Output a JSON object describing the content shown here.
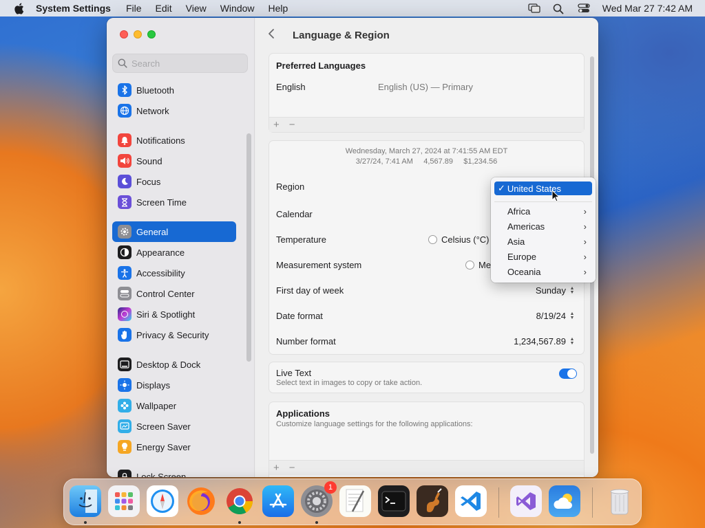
{
  "menubar": {
    "app_name": "System Settings",
    "menus": [
      "File",
      "Edit",
      "View",
      "Window",
      "Help"
    ],
    "datetime": "Wed Mar 27  7:42 AM"
  },
  "sidebar": {
    "search_placeholder": "Search",
    "items": [
      {
        "label": "Bluetooth",
        "icon": "bluetooth-icon",
        "color": "#1a73e8"
      },
      {
        "label": "Network",
        "icon": "globe-icon",
        "color": "#1a73e8"
      },
      {
        "label": "Notifications",
        "icon": "bell-icon",
        "color": "#f2453d"
      },
      {
        "label": "Sound",
        "icon": "speaker-icon",
        "color": "#f2453d"
      },
      {
        "label": "Focus",
        "icon": "moon-icon",
        "color": "#5b4fd8"
      },
      {
        "label": "Screen Time",
        "icon": "hourglass-icon",
        "color": "#6a4fd8"
      },
      {
        "label": "General",
        "icon": "gear-icon",
        "color": "#8e8e93"
      },
      {
        "label": "Appearance",
        "icon": "appearance-icon",
        "color": "#1d1d1f"
      },
      {
        "label": "Accessibility",
        "icon": "accessibility-icon",
        "color": "#1a73e8"
      },
      {
        "label": "Control Center",
        "icon": "control-center-icon",
        "color": "#8e8e93"
      },
      {
        "label": "Siri & Spotlight",
        "icon": "siri-icon",
        "color": "#c23bd4"
      },
      {
        "label": "Privacy & Security",
        "icon": "hand-icon",
        "color": "#1a73e8"
      },
      {
        "label": "Desktop & Dock",
        "icon": "dock-icon",
        "color": "#1d1d1f"
      },
      {
        "label": "Displays",
        "icon": "sun-icon",
        "color": "#1a73e8"
      },
      {
        "label": "Wallpaper",
        "icon": "flower-icon",
        "color": "#32aee8"
      },
      {
        "label": "Screen Saver",
        "icon": "screensaver-icon",
        "color": "#32aee8"
      },
      {
        "label": "Energy Saver",
        "icon": "bulb-icon",
        "color": "#f5a623"
      },
      {
        "label": "Lock Screen",
        "icon": "lock-icon",
        "color": "#1d1d1f"
      }
    ],
    "active_index": 6
  },
  "page": {
    "title": "Language & Region",
    "preferred_languages": {
      "heading": "Preferred Languages",
      "language": "English",
      "detail": "English (US) — Primary",
      "add": "+",
      "remove": "−"
    },
    "preview": {
      "line1": "Wednesday, March 27, 2024 at 7:41:55 AM EDT",
      "line2": "3/27/24, 7:41 AM     4,567.89     $1,234.56"
    },
    "settings": {
      "region": "Region",
      "calendar": "Calendar",
      "temperature": "Temperature",
      "celsius": "Celsius (°C)",
      "measurement": "Measurement system",
      "measurement_value": "Me",
      "first_day": "First day of week",
      "first_day_value": "Sunday",
      "date_format": "Date format",
      "date_format_value": "8/19/24",
      "number_format": "Number format",
      "number_format_value": "1,234,567.89"
    },
    "live_text": {
      "label": "Live Text",
      "desc": "Select text in images to copy or take action.",
      "enabled": true
    },
    "applications": {
      "heading": "Applications",
      "desc": "Customize language settings for the following applications:",
      "add": "+",
      "remove": "−"
    }
  },
  "popup": {
    "selected": "United States",
    "items": [
      "Africa",
      "Americas",
      "Asia",
      "Europe",
      "Oceania"
    ]
  },
  "dock": {
    "apps": [
      "Finder",
      "Launchpad",
      "Safari",
      "Firefox",
      "Chrome",
      "App Store",
      "System Settings",
      "TextEdit",
      "Terminal",
      "Instruments",
      "Visual Studio Code",
      "Visual Studio",
      "Weather",
      "Trash"
    ],
    "settings_badge": "1"
  }
}
